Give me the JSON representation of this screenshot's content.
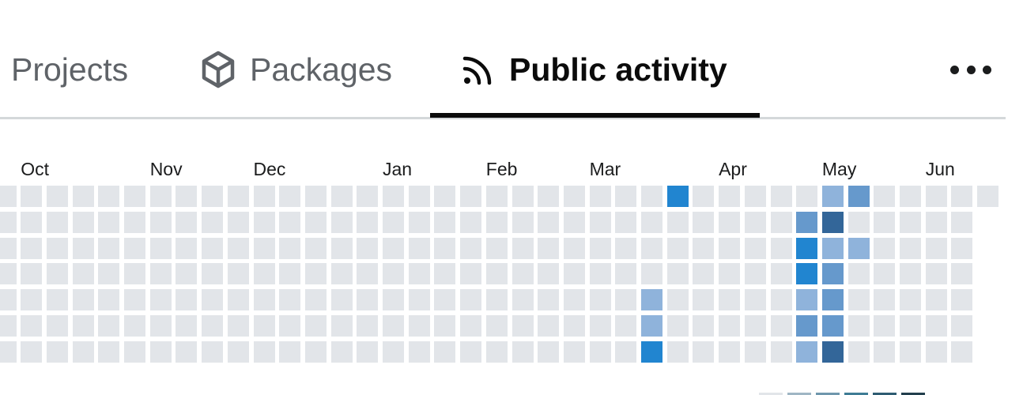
{
  "tabs": [
    {
      "label": "Projects",
      "icon": null,
      "active": false
    },
    {
      "label": "Packages",
      "icon": "package-icon",
      "active": false
    },
    {
      "label": "Public activity",
      "icon": "rss-icon",
      "active": true
    }
  ],
  "more_menu": {
    "icon": "more-horizontal-icon"
  },
  "colors": {
    "empty": "#e2e5e9",
    "level1": "#8fb3db",
    "level2": "#6699cc",
    "level3": "#2185d0",
    "level4": "#336699",
    "tab_inactive": "#5f6368",
    "tab_active": "#0b0b0b"
  },
  "chart_data": {
    "type": "heatmap",
    "title": "Public activity",
    "months": [
      {
        "label": "Oct",
        "week": 1
      },
      {
        "label": "Nov",
        "week": 6
      },
      {
        "label": "Dec",
        "week": 10
      },
      {
        "label": "Jan",
        "week": 15
      },
      {
        "label": "Feb",
        "week": 19
      },
      {
        "label": "Mar",
        "week": 23
      },
      {
        "label": "Apr",
        "week": 28
      },
      {
        "label": "May",
        "week": 32
      },
      {
        "label": "Jun",
        "week": 36
      }
    ],
    "weeks": 39,
    "days_per_week": 7,
    "last_week_days": 1,
    "levels_legend": [
      "empty",
      "level1",
      "level2",
      "level3",
      "level4"
    ],
    "active_cells": [
      {
        "week": 26,
        "day": 0,
        "level": 3
      },
      {
        "week": 25,
        "day": 4,
        "level": 1
      },
      {
        "week": 25,
        "day": 5,
        "level": 1
      },
      {
        "week": 25,
        "day": 6,
        "level": 3
      },
      {
        "week": 31,
        "day": 1,
        "level": 2
      },
      {
        "week": 31,
        "day": 2,
        "level": 3
      },
      {
        "week": 31,
        "day": 3,
        "level": 3
      },
      {
        "week": 31,
        "day": 4,
        "level": 1
      },
      {
        "week": 31,
        "day": 5,
        "level": 2
      },
      {
        "week": 31,
        "day": 6,
        "level": 1
      },
      {
        "week": 32,
        "day": 0,
        "level": 1
      },
      {
        "week": 32,
        "day": 1,
        "level": 4
      },
      {
        "week": 32,
        "day": 2,
        "level": 1
      },
      {
        "week": 32,
        "day": 3,
        "level": 2
      },
      {
        "week": 32,
        "day": 4,
        "level": 2
      },
      {
        "week": 32,
        "day": 5,
        "level": 2
      },
      {
        "week": 32,
        "day": 6,
        "level": 4
      },
      {
        "week": 33,
        "day": 0,
        "level": 2
      },
      {
        "week": 33,
        "day": 2,
        "level": 1
      }
    ]
  },
  "legend_colors": [
    "#e2e5e9",
    "#9fb6c4",
    "#6f97ad",
    "#3f7c95",
    "#2f5c72",
    "#223f4d"
  ]
}
